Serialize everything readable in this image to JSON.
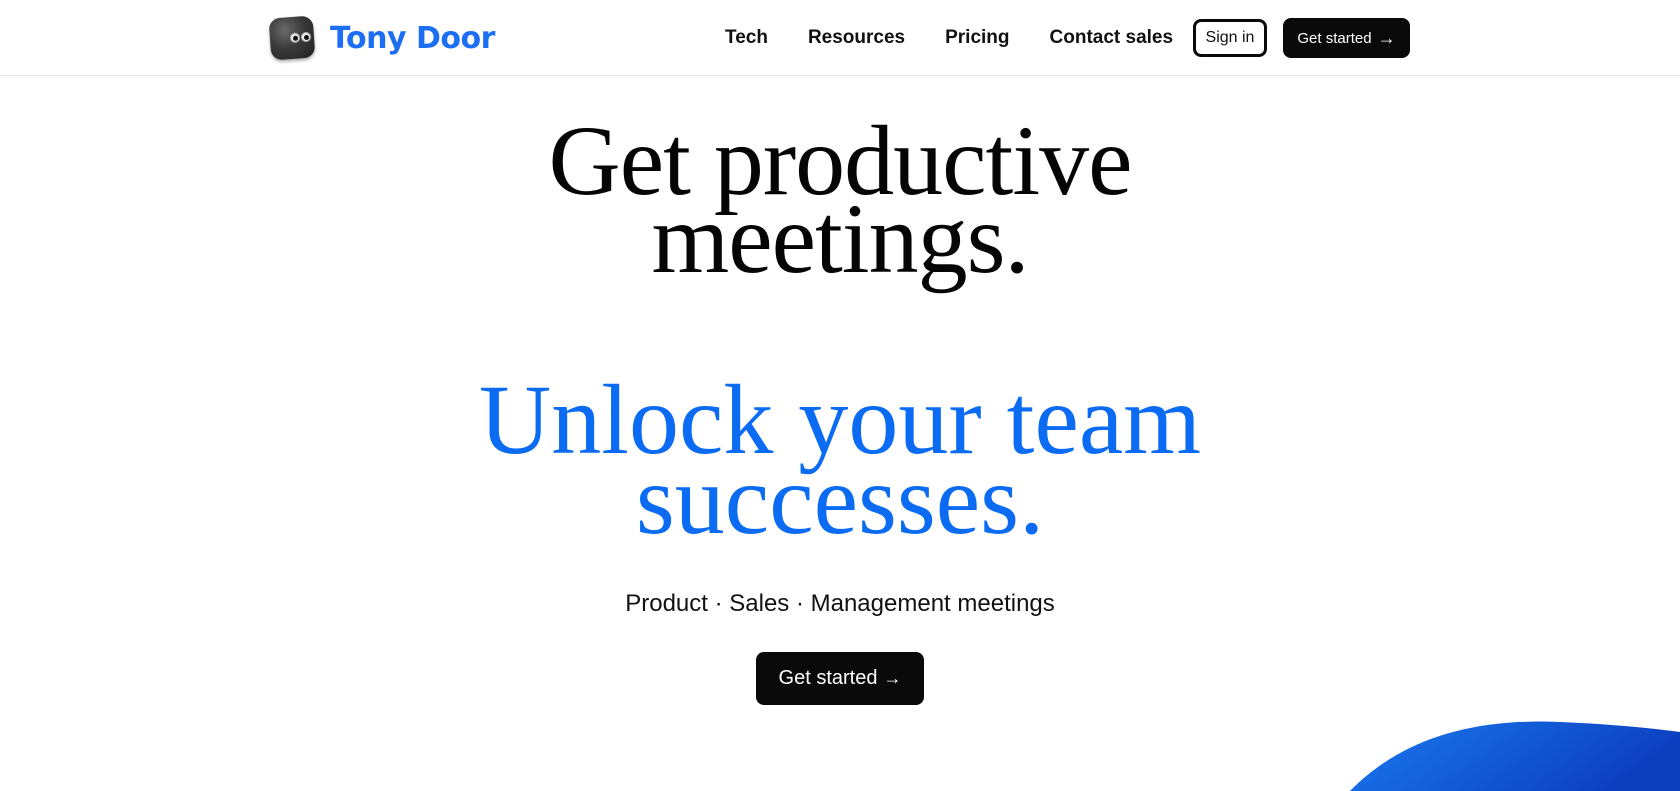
{
  "brand": {
    "name": "Tony Door",
    "logo_icon": "cube-mascot-icon",
    "color": "#1c6ef2"
  },
  "nav": {
    "links": [
      {
        "label": "Tech"
      },
      {
        "label": "Resources"
      },
      {
        "label": "Pricing"
      },
      {
        "label": "Contact sales"
      }
    ],
    "sign_in_label": "Sign in",
    "get_started_label": "Get started",
    "arrow_icon": "→"
  },
  "hero": {
    "headline_line1": "Get productive",
    "headline_line2": "meetings.",
    "subheadline_line1": "Unlock your team",
    "subheadline_line2": "successes.",
    "subheadline_color": "#0b6cf3",
    "tagline": "Product · Sales · Management meetings",
    "cta_label": "Get started",
    "cta_arrow": "→"
  },
  "decor": {
    "blob_colors": [
      "#1a7af0",
      "#0d3fbf"
    ]
  }
}
